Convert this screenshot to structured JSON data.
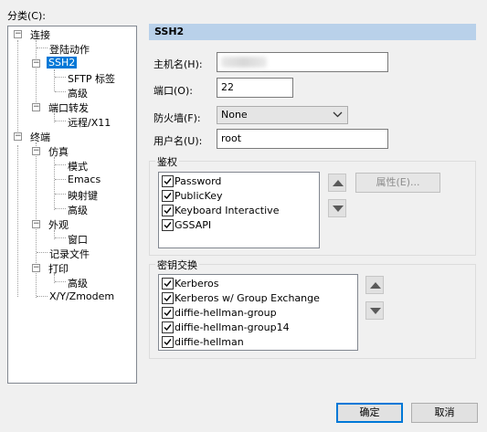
{
  "category": {
    "label": "分类(C):"
  },
  "tree": {
    "connection": "连接",
    "login_actions": "登陆动作",
    "ssh2": "SSH2",
    "sftp_tab": "SFTP 标签",
    "advanced": "高级",
    "port_forwarding": "端口转发",
    "remote_x11": "远程/X11",
    "terminal": "终端",
    "emulation": "仿真",
    "modes": "模式",
    "emacs": "Emacs",
    "keymap": "映射键",
    "appearance": "外观",
    "window": "窗口",
    "log_file": "记录文件",
    "print": "打印",
    "xymodem": "X/Y/Zmodem"
  },
  "header": {
    "title": "SSH2"
  },
  "form": {
    "hostname_label": "主机名(H):",
    "hostname_value": "",
    "port_label": "端口(O):",
    "port_value": "22",
    "firewall_label": "防火墙(F):",
    "firewall_value": "None",
    "username_label": "用户名(U):",
    "username_value": "root"
  },
  "auth": {
    "title": "鉴权",
    "items": [
      {
        "label": "Password",
        "checked": true
      },
      {
        "label": "PublicKey",
        "checked": true
      },
      {
        "label": "Keyboard Interactive",
        "checked": true
      },
      {
        "label": "GSSAPI",
        "checked": true
      }
    ],
    "properties_label": "属性(E)..."
  },
  "kex": {
    "title": "密钥交换",
    "items": [
      {
        "label": "Kerberos",
        "checked": true
      },
      {
        "label": "Kerberos w/ Group Exchange",
        "checked": true
      },
      {
        "label": "diffie-hellman-group",
        "checked": true
      },
      {
        "label": "diffie-hellman-group14",
        "checked": true
      },
      {
        "label": "diffie-hellman",
        "checked": true
      }
    ]
  },
  "footer": {
    "ok_label": "确定",
    "cancel_label": "取消"
  },
  "colors": {
    "selection": "#0078d7",
    "header": "#b9d1ea"
  }
}
